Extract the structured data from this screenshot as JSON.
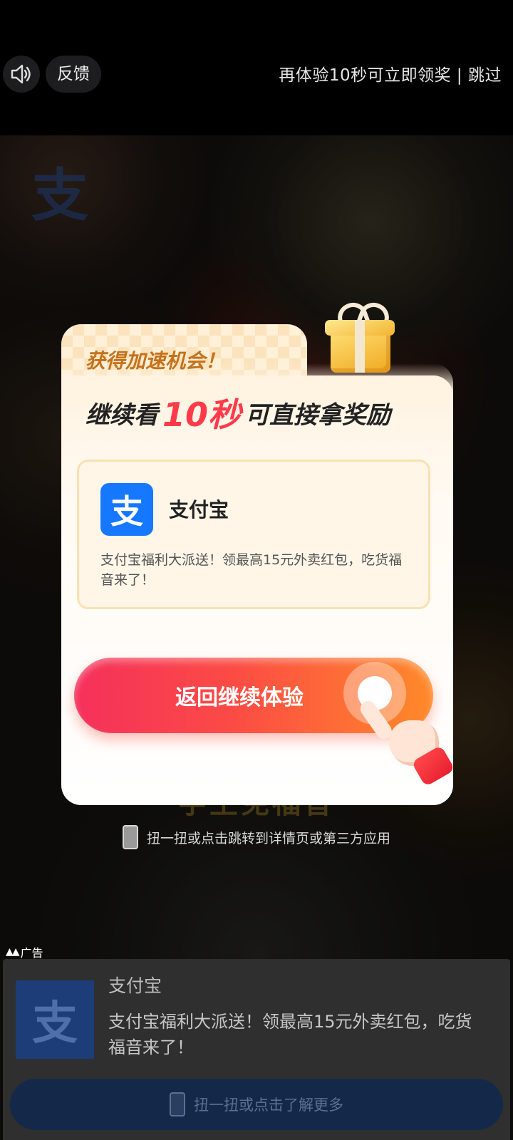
{
  "topbar": {
    "sound_icon": "speaker-icon",
    "feedback_label": "反馈",
    "skip_text": "再体验10秒可立即领奖 | 跳过"
  },
  "video": {
    "logo_glyph": "支",
    "caption": "字王免福音",
    "shake_hint": "扭一扭或点击跳转到详情页或第三方应用"
  },
  "ad_label": "广告",
  "ad_bar": {
    "logo_glyph": "支",
    "title": "支付宝",
    "description": "支付宝福利大派送！领最高15元外卖红包，吃货福音来了！",
    "cta": "扭一扭或点击了解更多"
  },
  "modal": {
    "head_small": "获得加速机会！",
    "head_big_prefix": "继续看",
    "head_big_highlight": "10秒",
    "head_big_suffix": "可直接拿奖励",
    "ad_card": {
      "logo_glyph": "支",
      "title": "支付宝",
      "description": "支付宝福利大派送！领最高15元外卖红包，吃货福音来了！"
    },
    "cta_label": "返回继续体验"
  },
  "colors": {
    "accent_red": "#ff3b4a",
    "alipay_blue": "#1677ff",
    "cta_gradient_start": "#f5305c",
    "cta_gradient_end": "#ff8a2a"
  }
}
